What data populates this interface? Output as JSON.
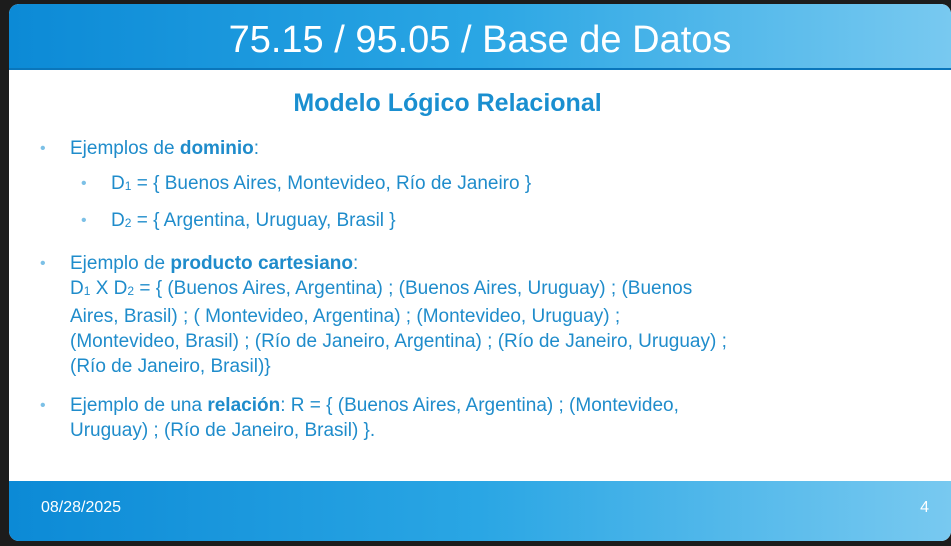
{
  "header": {
    "title": "75.15 / 95.05 / Base de Datos"
  },
  "subtitle": "Modelo Lógico Relacional",
  "bullet1": {
    "prefix": "Ejemplos de ",
    "bold": "dominio",
    "suffix": ":",
    "items": [
      {
        "d": "D",
        "sub": "1",
        "text": " = { Buenos Aires, Montevideo, Río de Janeiro }"
      },
      {
        "d": "D",
        "sub": "2",
        "text": " = { Argentina, Uruguay, Brasil }"
      }
    ]
  },
  "bullet2": {
    "prefix": "Ejemplo de ",
    "bold": "producto cartesiano",
    "suffix": ":",
    "d1": "D",
    "sub1": "1",
    "x": " X D",
    "sub2": "2",
    "line1": " = { (Buenos Aires, Argentina) ; (Buenos Aires, Uruguay) ; (Buenos",
    "line2": "Aires, Brasil) ; ( Montevideo, Argentina) ; (Montevideo, Uruguay) ;",
    "line3": "(Montevideo, Brasil) ; (Río de Janeiro, Argentina) ; (Río de Janeiro, Uruguay) ;",
    "line4": "(Río de Janeiro, Brasil)}"
  },
  "bullet3": {
    "prefix": "Ejemplo de una ",
    "bold": "relación",
    "line1": ": R = { (Buenos Aires, Argentina) ; (Montevideo,",
    "line2": "Uruguay) ; (Río de Janeiro, Brasil) }."
  },
  "footer": {
    "date": "08/28/2025",
    "page": "4"
  },
  "bullet_glyph": "•"
}
